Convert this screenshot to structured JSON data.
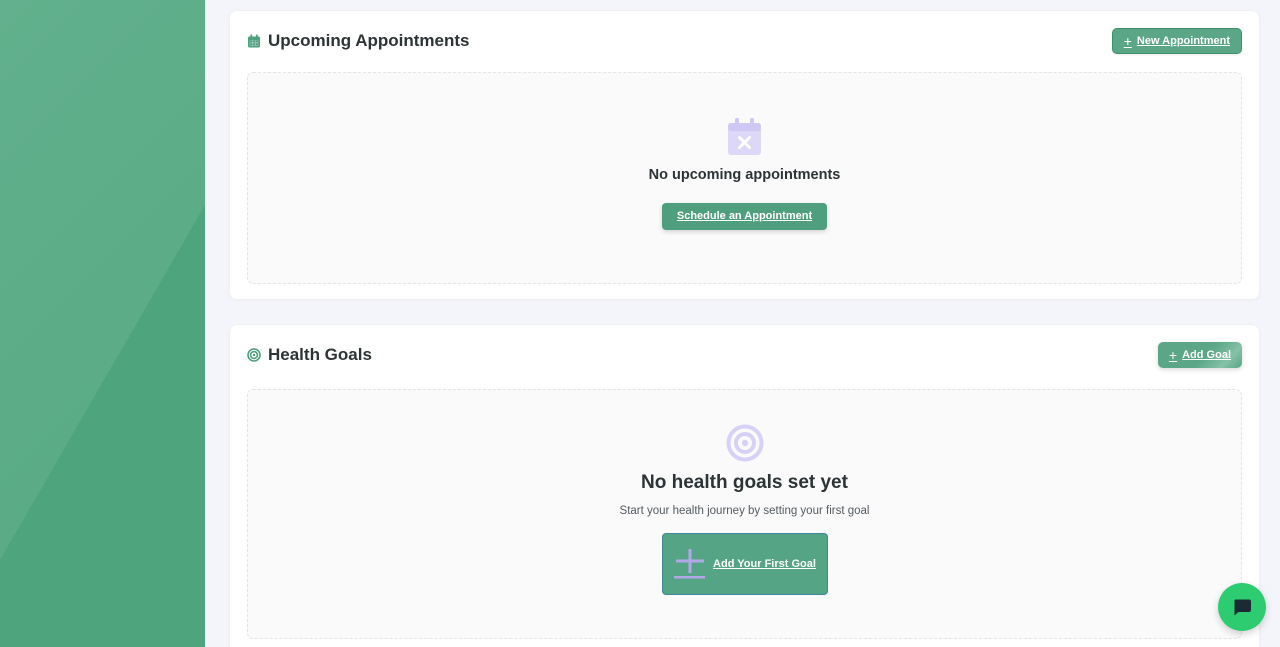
{
  "appointments": {
    "title": "Upcoming Appointments",
    "title_icon": "calendar-icon",
    "new_button": "New Appointment",
    "empty_icon": "calendar-x-icon",
    "empty_title": "No upcoming appointments",
    "schedule_button": "Schedule an Appointment"
  },
  "goals": {
    "title": "Health Goals",
    "title_icon": "target-icon",
    "add_button": "Add Goal",
    "empty_icon": "target-icon",
    "empty_title": "No health goals set yet",
    "empty_subtitle": "Start your health journey by setting your first goal",
    "first_goal_button": "Add Your First Goal"
  },
  "chat": {
    "icon": "chat-bubble-icon"
  },
  "colors": {
    "brand_green": "#5aa687",
    "sidebar": "#62b08d",
    "chat_fab": "#2ecc71",
    "empty_icon": "#d6d1f5"
  }
}
